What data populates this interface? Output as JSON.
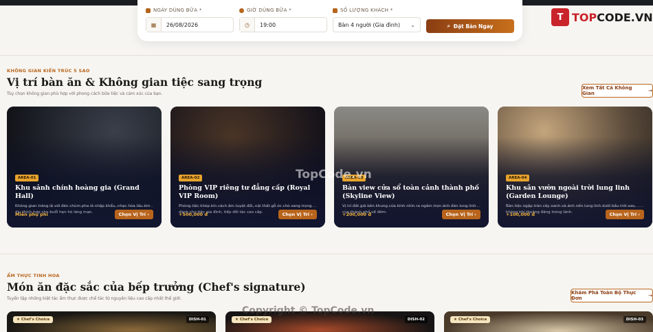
{
  "booking": {
    "date_label": "NGÀY DÙNG BỮA *",
    "date_value": "26/08/2026",
    "time_label": "GIỜ DÙNG BỮA *",
    "time_value": "19:00",
    "guests_label": "SỐ LƯỢNG KHÁCH *",
    "guests_value": "Bàn 4 người (Gia đình)",
    "submit_label": "Đặt Bàn Ngay"
  },
  "logo": {
    "brand_a": "TOP",
    "brand_b": "CODE.VN"
  },
  "spaces": {
    "eyebrow": "KHÔNG GIAN KIẾN TRÚC 5 SAO",
    "title": "Vị trí bàn ăn & Không gian tiệc sang trọng",
    "subtitle": "Tùy chọn không gian phù hợp với phong cách bữa tiệc và cảm xúc của bạn.",
    "view_all": "Xem Tất Cả Không Gian",
    "cards": [
      {
        "badge": "AREA-01",
        "title": "Khu sảnh chính hoàng gia (Grand Hall)",
        "desc": "Không gian tráng lệ với đèn chùm pha lê nhập khẩu, nhạc hòa tấu êm dịu thích hợp cho buổi hẹn hò lãng mạn.",
        "price": "Miễn phụ phí",
        "cta": "Chọn Vị Trí"
      },
      {
        "badge": "AREA-02",
        "title": "Phòng VIP riêng tư đẳng cấp (Royal VIP Room)",
        "desc": "Phòng tiệc khép kín cách âm tuyệt đối, nội thất gỗ óc chó sang trọng dành cho tiệc gia đình, tiếp đối tác cao cấp.",
        "price": "+500,000 đ",
        "cta": "Chọn Vị Trí"
      },
      {
        "badge": "AREA-03",
        "title": "Bàn view cửa sổ toàn cảnh thành phố (Skyline View)",
        "desc": "Vị trí đắt giá bên khung cửa kính nhìn ra ngắm trọn ánh đèn lung linh của thành phố về đêm.",
        "price": "+200,000 đ",
        "cta": "Chọn Vị Trí"
      },
      {
        "badge": "AREA-04",
        "title": "Khu sân vườn ngoài trời lung linh (Garden Lounge)",
        "desc": "Bàn tiệc ngập tràn cây xanh và ánh nến lung linh dưới bầu trời sao, không khí thoáng đãng trong lành.",
        "price": "+100,000 đ",
        "cta": "Chọn Vị Trí"
      }
    ]
  },
  "dishes": {
    "eyebrow": "ẨM THỰC TINH HOA",
    "title": "Món ăn đặc sắc của bếp trưởng (Chef's signature)",
    "subtitle": "Tuyển tập những kiệt tác ẩm thực được chế tác từ nguyên liệu cao cấp nhất thế giới.",
    "explore": "Khám Phá Toàn Bộ Thực Đơn",
    "items": [
      {
        "chef": "Chef's Choice",
        "tag": "DISH-01"
      },
      {
        "chef": "Chef's Choice",
        "tag": "DISH-02"
      },
      {
        "chef": "Chef's Choice",
        "tag": "DISH-03"
      }
    ]
  },
  "watermarks": {
    "center": "TopCode.vn",
    "footer": "Copyright © TopCode.vn"
  }
}
